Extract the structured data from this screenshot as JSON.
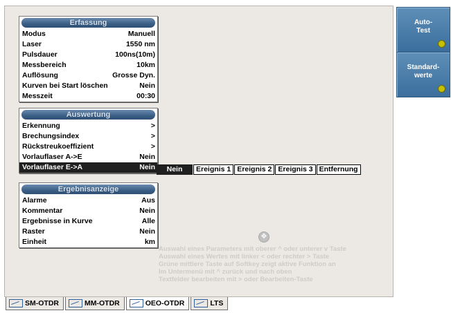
{
  "erfassung": {
    "title": "Erfassung",
    "rows": [
      {
        "label": "Modus",
        "value": "Manuell"
      },
      {
        "label": "Laser",
        "value": "1550 nm"
      },
      {
        "label": "Pulsdauer",
        "value": "100ns(10m)"
      },
      {
        "label": "Messbereich",
        "value": "10km"
      },
      {
        "label": "Auflösung",
        "value": "Grosse Dyn."
      },
      {
        "label": "Kurven bei Start löschen",
        "value": "Nein"
      },
      {
        "label": "Messzeit",
        "value": "00:30"
      }
    ]
  },
  "auswertung": {
    "title": "Auswertung",
    "rows": [
      {
        "label": "Erkennung",
        "value": ">"
      },
      {
        "label": "Brechungsindex",
        "value": ">"
      },
      {
        "label": "Rückstreukoeffizient",
        "value": ">"
      },
      {
        "label": "Vorlauflaser A->E",
        "value": "Nein"
      },
      {
        "label": "Vorlauflaser E->A",
        "value": "Nein"
      }
    ]
  },
  "options": [
    "Nein",
    "Ereignis 1",
    "Ereignis 2",
    "Ereignis 3",
    "Entfernung"
  ],
  "ergebnisanzeige": {
    "title": "Ergebnisanzeige",
    "rows": [
      {
        "label": "Alarme",
        "value": "Aus"
      },
      {
        "label": "Kommentar",
        "value": "Nein"
      },
      {
        "label": "Ergebnisse in Kurve",
        "value": "Alle"
      },
      {
        "label": "Raster",
        "value": "Nein"
      },
      {
        "label": "Einheit",
        "value": "km"
      }
    ]
  },
  "help": {
    "lines": [
      "Auswahl eines Parameters mit oberer ^ oder unterer v Taste",
      "Auswahl eines Wertes mit linker < oder rechter > Taste",
      "Grüne mittlere Taste auf Softkey zeigt aktive Funktion an",
      "Im Untermenü mit ^ zurück und nach oben",
      "Textfelder bearbeiten mit > oder Bearbeiten-Taste"
    ]
  },
  "tabs": [
    "SM-OTDR",
    "MM-OTDR",
    "OEO-OTDR",
    "LTS"
  ],
  "softkeys": {
    "auto_test": "Auto-\nTest",
    "standardwerte": "Standard-\nwerte"
  }
}
